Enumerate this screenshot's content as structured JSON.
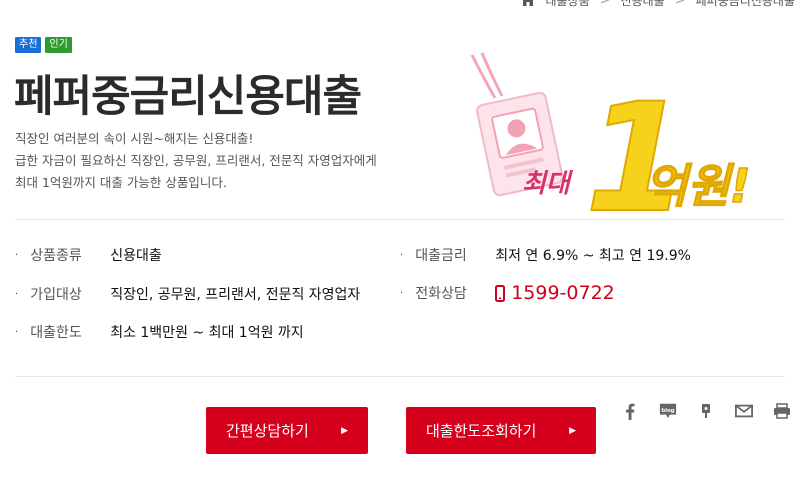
{
  "breadcrumb": {
    "items": [
      "대출상품",
      "신용대출",
      "페퍼중금리신용대출"
    ],
    "separator": ">"
  },
  "badges": {
    "recommended": "추천",
    "popular": "인기"
  },
  "page_title": "페퍼중금리신용대출",
  "description": [
    "직장인 여러분의 속이 시원~해지는 신용대출!",
    "급한 자금이 필요하신 직장인, 공무원, 프리랜서, 전문직 자영업자에게",
    "최대 1억원까지 대출 가능한 상품입니다."
  ],
  "promo": {
    "prefix": "최대",
    "amount": "1",
    "unit": "억원!"
  },
  "info": {
    "product_type": {
      "label": "상품종류",
      "value": "신용대출"
    },
    "eligibility": {
      "label": "가입대상",
      "value": "직장인, 공무원, 프리랜서, 전문직 자영업자"
    },
    "limit": {
      "label": "대출한도",
      "value": "최소 1백만원 ~ 최대 1억원 까지"
    },
    "rate": {
      "label": "대출금리",
      "value": "최저 연 6.9% ~ 최고 연 19.9%"
    },
    "phone": {
      "label": "전화상담",
      "value": "1599-0722"
    }
  },
  "buttons": {
    "consult": "간편상담하기",
    "limit_check": "대출한도조회하기",
    "arrow": "▶"
  },
  "share_icons": [
    "facebook-icon",
    "blog-icon",
    "kakao-story-icon",
    "mail-icon",
    "print-icon"
  ],
  "colors": {
    "accent": "#d5001c",
    "badge_recommended": "#1a6fd6",
    "badge_popular": "#2e9b2e",
    "promo_yellow": "#f7d21c",
    "promo_pink": "#d6336c"
  }
}
